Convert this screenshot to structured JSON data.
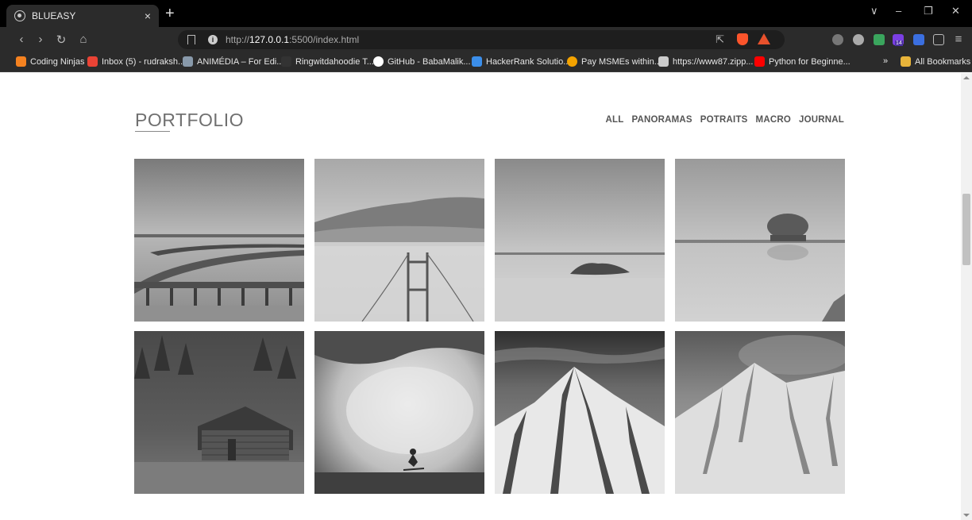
{
  "browser": {
    "tab_title": "BLUEASY",
    "tab_close": "×",
    "new_tab": "+",
    "url_prefix": "http://",
    "url_host": "127.0.0.1",
    "url_rest": ":5500/index.html",
    "ext_badge": "14"
  },
  "bookmarks": [
    {
      "label": "Coding Ninjas",
      "icon": "coding-ninjas-icon",
      "color": "#f58220"
    },
    {
      "label": "Inbox (5) - rudraksh...",
      "icon": "gmail-icon",
      "color": "#ea4335"
    },
    {
      "label": "ANIMÉDIA – For Edi...",
      "icon": "animedia-icon",
      "color": "#8899aa"
    },
    {
      "label": "Ringwitdahoodie T...",
      "icon": "ringwit-icon",
      "color": "#333333"
    },
    {
      "label": "GitHub - BabaMalik...",
      "icon": "github-icon",
      "color": "#ffffff"
    },
    {
      "label": "HackerRank Solutio...",
      "icon": "hackerrank-icon",
      "color": "#3b8eea"
    },
    {
      "label": "Pay MSMEs within...",
      "icon": "msme-icon",
      "color": "#f4a300"
    },
    {
      "label": "https://www87.zipp...",
      "icon": "zipp-icon",
      "color": "#cccccc"
    },
    {
      "label": "Python for Beginne...",
      "icon": "youtube-icon",
      "color": "#ff0000"
    }
  ],
  "bookmarks_overflow": "»",
  "all_bookmarks": "All Bookmarks",
  "portfolio": {
    "title": "PORTFOLIO",
    "filters": [
      "ALL",
      "PANORAMAS",
      "POTRAITS",
      "MACRO",
      "JOURNAL"
    ]
  },
  "gallery": [
    {
      "name": "pier-photo"
    },
    {
      "name": "golden-gate-fog-photo"
    },
    {
      "name": "calm-lake-island-photo"
    },
    {
      "name": "tree-island-photo"
    },
    {
      "name": "log-cabin-forest-photo"
    },
    {
      "name": "surfer-wave-photo"
    },
    {
      "name": "snowy-peak-photo"
    },
    {
      "name": "snow-mountain-slope-photo"
    }
  ]
}
